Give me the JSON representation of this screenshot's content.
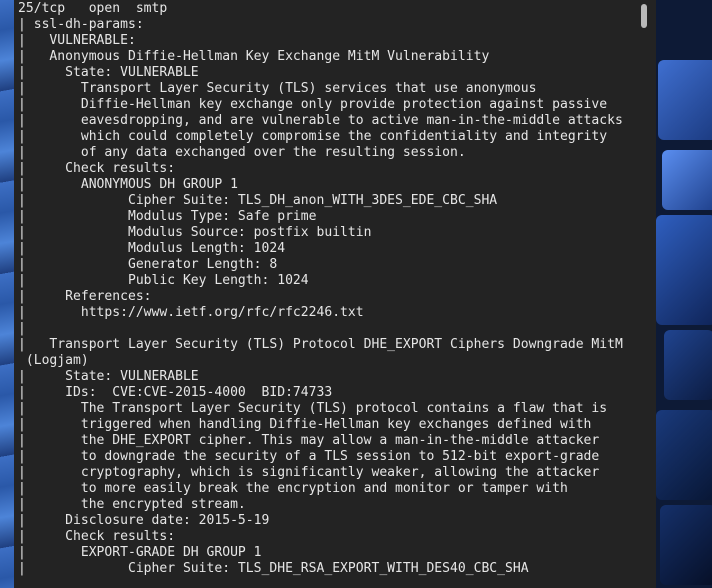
{
  "terminal": {
    "lines": [
      "25/tcp   open  smtp",
      "| ssl-dh-params:",
      "|   VULNERABLE:",
      "|   Anonymous Diffie-Hellman Key Exchange MitM Vulnerability",
      "|     State: VULNERABLE",
      "|       Transport Layer Security (TLS) services that use anonymous",
      "|       Diffie-Hellman key exchange only provide protection against passive",
      "|       eavesdropping, and are vulnerable to active man-in-the-middle attacks",
      "|       which could completely compromise the confidentiality and integrity",
      "|       of any data exchanged over the resulting session.",
      "|     Check results:",
      "|       ANONYMOUS DH GROUP 1",
      "|             Cipher Suite: TLS_DH_anon_WITH_3DES_EDE_CBC_SHA",
      "|             Modulus Type: Safe prime",
      "|             Modulus Source: postfix builtin",
      "|             Modulus Length: 1024",
      "|             Generator Length: 8",
      "|             Public Key Length: 1024",
      "|     References:",
      "|       https://www.ietf.org/rfc/rfc2246.txt",
      "|",
      "|   Transport Layer Security (TLS) Protocol DHE_EXPORT Ciphers Downgrade MitM",
      " (Logjam)",
      "|     State: VULNERABLE",
      "|     IDs:  CVE:CVE-2015-4000  BID:74733",
      "|       The Transport Layer Security (TLS) protocol contains a flaw that is",
      "|       triggered when handling Diffie-Hellman key exchanges defined with",
      "|       the DHE_EXPORT cipher. This may allow a man-in-the-middle attacker",
      "|       to downgrade the security of a TLS session to 512-bit export-grade",
      "|       cryptography, which is significantly weaker, allowing the attacker",
      "|       to more easily break the encryption and monitor or tamper with",
      "|       the encrypted stream.",
      "|     Disclosure date: 2015-5-19",
      "|     Check results:",
      "|       EXPORT-GRADE DH GROUP 1",
      "|             Cipher Suite: TLS_DHE_RSA_EXPORT_WITH_DES40_CBC_SHA"
    ]
  },
  "colors": {
    "terminal_bg": "#232323",
    "terminal_fg": "#e6e6e6",
    "scrollbar_thumb": "#b9b9b9"
  }
}
